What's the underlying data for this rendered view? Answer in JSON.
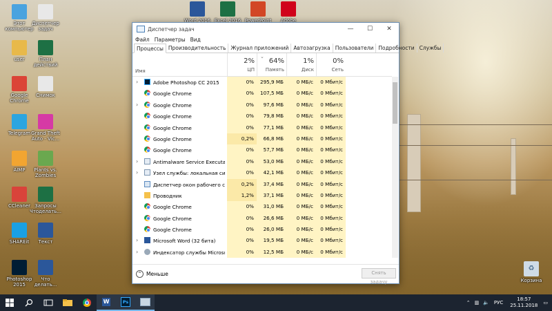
{
  "desktop": {
    "icons_left": [
      {
        "label": "Этот компьютер",
        "icon": "computer-icon",
        "color": "#4aa3df"
      },
      {
        "label": "Диспетчер задач",
        "icon": "document-icon",
        "color": "#e8e8e8"
      },
      {
        "label": "user",
        "icon": "user-folder-icon",
        "color": "#e8b94a"
      },
      {
        "label": "План действий",
        "icon": "excel-icon",
        "color": "#1d7044"
      },
      {
        "label": "Google Chrome",
        "icon": "chrome-icon",
        "color": "#db4437"
      },
      {
        "label": "Снимок",
        "icon": "document-icon",
        "color": "#e8e8e8"
      },
      {
        "label": "Telegram",
        "icon": "telegram-icon",
        "color": "#2ca5e0"
      },
      {
        "label": "Grand Theft Auto - Vic...",
        "icon": "game-icon",
        "color": "#d63aa5"
      },
      {
        "label": "AIMP",
        "icon": "aimp-icon",
        "color": "#f2a531"
      },
      {
        "label": "Plants vs. Zombies",
        "icon": "game-icon",
        "color": "#6aa84f"
      },
      {
        "label": "CCleaner",
        "icon": "ccleaner-icon",
        "color": "#d9433a"
      },
      {
        "label": "Запросы Чтоделать...",
        "icon": "excel-icon",
        "color": "#1d7044"
      },
      {
        "label": "SHAREit",
        "icon": "shareit-icon",
        "color": "#1aa0e3"
      },
      {
        "label": "Текст",
        "icon": "word-icon",
        "color": "#2b579a"
      },
      {
        "label": "Photoshop 2015",
        "icon": "photoshop-icon",
        "color": "#001d34"
      },
      {
        "label": "Что делать...",
        "icon": "word-icon",
        "color": "#2b579a"
      }
    ],
    "icons_top": [
      {
        "label": "Word 2016",
        "icon": "word-icon",
        "color": "#2b579a"
      },
      {
        "label": "Excel 2016",
        "icon": "excel-icon",
        "color": "#1d7044"
      },
      {
        "label": "PowerPoint",
        "icon": "powerpoint-icon",
        "color": "#d24726"
      },
      {
        "label": "Adobe",
        "icon": "acrobat-icon",
        "color": "#d0021b"
      }
    ],
    "recycle_bin": {
      "label": "Корзина",
      "icon": "recycle-bin-icon"
    }
  },
  "window": {
    "title": "Диспетчер задач",
    "menu": [
      "Файл",
      "Параметры",
      "Вид"
    ],
    "tabs": [
      "Процессы",
      "Производительность",
      "Журнал приложений",
      "Автозагрузка",
      "Пользователи",
      "Подробности",
      "Службы"
    ],
    "active_tab": "Процессы",
    "columns": {
      "name": "Имя",
      "cpu": {
        "pct": "2%",
        "label": "ЦП"
      },
      "mem": {
        "pct": "64%",
        "label": "Память"
      },
      "disk": {
        "pct": "1%",
        "label": "Диск"
      },
      "net": {
        "pct": "0%",
        "label": "Сеть"
      }
    },
    "rows": [
      {
        "name": "Adobe Photoshop CC 2015",
        "expand": "›",
        "icon": "photoshop-icon",
        "cpu": "0%",
        "mem": "295,9 МБ",
        "disk": "0 МБ/с",
        "net": "0 Мбит/с"
      },
      {
        "name": "Google Chrome",
        "expand": "",
        "icon": "chrome-icon",
        "cpu": "0%",
        "mem": "107,5 МБ",
        "disk": "0 МБ/с",
        "net": "0 Мбит/с"
      },
      {
        "name": "Google Chrome",
        "expand": "›",
        "icon": "chrome-icon",
        "cpu": "0%",
        "mem": "97,6 МБ",
        "disk": "0 МБ/с",
        "net": "0 Мбит/с"
      },
      {
        "name": "Google Chrome",
        "expand": "",
        "icon": "chrome-icon",
        "cpu": "0%",
        "mem": "79,8 МБ",
        "disk": "0 МБ/с",
        "net": "0 Мбит/с"
      },
      {
        "name": "Google Chrome",
        "expand": "",
        "icon": "chrome-icon",
        "cpu": "0%",
        "mem": "77,1 МБ",
        "disk": "0 МБ/с",
        "net": "0 Мбит/с"
      },
      {
        "name": "Google Chrome",
        "expand": "",
        "icon": "chrome-icon",
        "cpu": "0,2%",
        "mem": "66,8 МБ",
        "disk": "0 МБ/с",
        "net": "0 Мбит/с"
      },
      {
        "name": "Google Chrome",
        "expand": "",
        "icon": "chrome-icon",
        "cpu": "0%",
        "mem": "57,7 МБ",
        "disk": "0 МБ/с",
        "net": "0 Мбит/с"
      },
      {
        "name": "Antimalware Service Executable",
        "expand": "›",
        "icon": "service-icon",
        "cpu": "0%",
        "mem": "53,0 МБ",
        "disk": "0 МБ/с",
        "net": "0 Мбит/с"
      },
      {
        "name": "Узел службы: локальная сист...",
        "expand": "›",
        "icon": "service-icon",
        "cpu": "0%",
        "mem": "42,1 МБ",
        "disk": "0 МБ/с",
        "net": "0 Мбит/с"
      },
      {
        "name": "Диспетчер окон рабочего сто...",
        "expand": "",
        "icon": "window-icon",
        "cpu": "0,2%",
        "mem": "37,4 МБ",
        "disk": "0 МБ/с",
        "net": "0 Мбит/с"
      },
      {
        "name": "Проводник",
        "expand": "",
        "icon": "folder-icon",
        "cpu": "1,2%",
        "mem": "37,1 МБ",
        "disk": "0 МБ/с",
        "net": "0 Мбит/с"
      },
      {
        "name": "Google Chrome",
        "expand": "",
        "icon": "chrome-icon",
        "cpu": "0%",
        "mem": "31,0 МБ",
        "disk": "0 МБ/с",
        "net": "0 Мбит/с"
      },
      {
        "name": "Google Chrome",
        "expand": "",
        "icon": "chrome-icon",
        "cpu": "0%",
        "mem": "26,6 МБ",
        "disk": "0 МБ/с",
        "net": "0 Мбит/с"
      },
      {
        "name": "Google Chrome",
        "expand": "",
        "icon": "chrome-icon",
        "cpu": "0%",
        "mem": "26,0 МБ",
        "disk": "0 МБ/с",
        "net": "0 Мбит/с"
      },
      {
        "name": "Microsoft Word (32 бита)",
        "expand": "›",
        "icon": "word-icon",
        "cpu": "0%",
        "mem": "19,5 МБ",
        "disk": "0 МБ/с",
        "net": "0 Мбит/с"
      },
      {
        "name": "Индексатор службы Microsoft...",
        "expand": "›",
        "icon": "indexer-icon",
        "cpu": "0%",
        "mem": "12,5 МБ",
        "disk": "0 МБ/с",
        "net": "0 Мбит/с"
      }
    ],
    "footer": {
      "less_label": "Меньше",
      "end_task_label": "Снять задачу"
    }
  },
  "taskbar": {
    "items": [
      {
        "name": "start-button",
        "icon": "windows-icon"
      },
      {
        "name": "search-button",
        "icon": "search-icon"
      },
      {
        "name": "task-view-button",
        "icon": "task-view-icon"
      },
      {
        "name": "explorer-button",
        "icon": "folder-icon"
      },
      {
        "name": "chrome-button",
        "icon": "chrome-icon"
      },
      {
        "name": "word-button",
        "icon": "word-icon"
      },
      {
        "name": "photoshop-button",
        "icon": "photoshop-icon"
      },
      {
        "name": "task-manager-button",
        "icon": "task-manager-icon"
      }
    ],
    "tray": {
      "lang": "РУС",
      "time": "18:57",
      "date": "25.11.2018"
    }
  }
}
